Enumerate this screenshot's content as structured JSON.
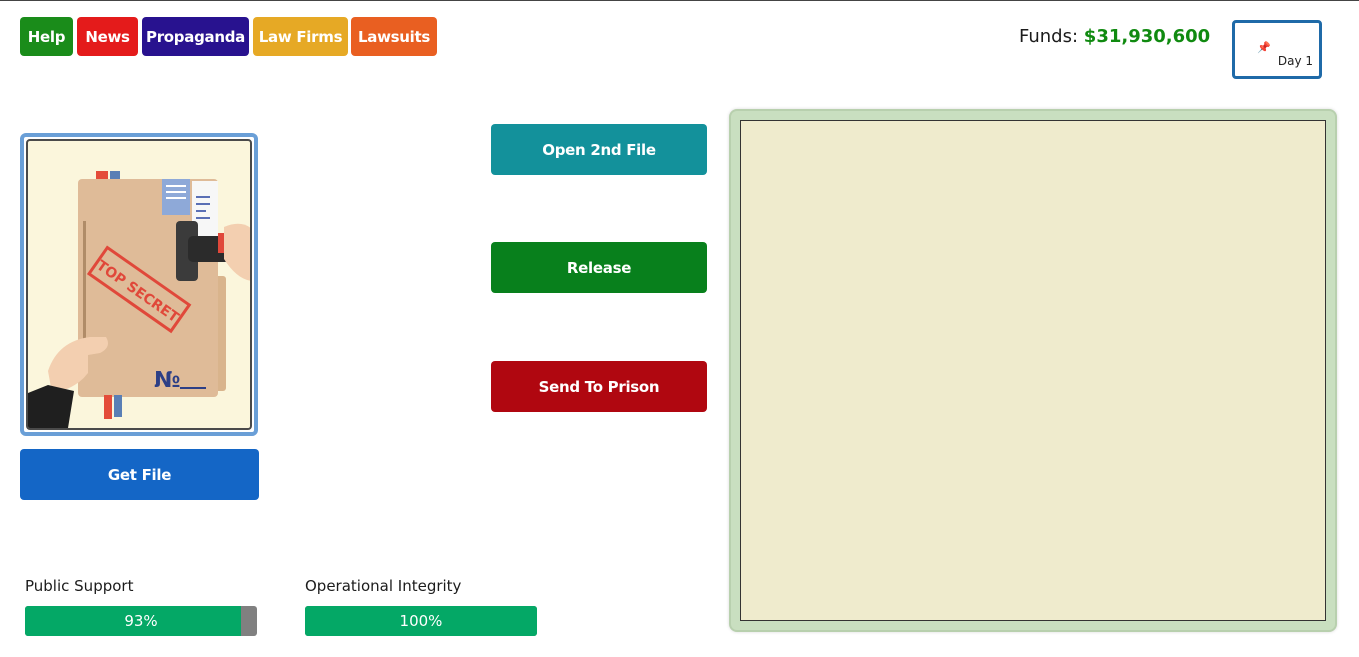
{
  "nav": {
    "help": {
      "label": "Help",
      "color": "#1a8c1a"
    },
    "news": {
      "label": "News",
      "color": "#e41b1b"
    },
    "propaganda": {
      "label": "Propaganda",
      "color": "#28128f"
    },
    "law_firms": {
      "label": "Law Firms",
      "color": "#e6a925"
    },
    "lawsuits": {
      "label": "Lawsuits",
      "color": "#e95f21"
    }
  },
  "funds": {
    "label": "Funds:",
    "amount": "$31,930,600"
  },
  "day": {
    "label": "Day 1"
  },
  "file_card": {
    "stamp_text": "TOP SECRET",
    "number_mark": "№"
  },
  "buttons": {
    "get_file": {
      "label": "Get File",
      "color": "#1466c6"
    },
    "open_second": {
      "label": "Open 2nd File",
      "color": "#13919b"
    },
    "release": {
      "label": "Release",
      "color": "#08801c"
    },
    "send_prison": {
      "label": "Send To Prison",
      "color": "#b00710"
    }
  },
  "stats": {
    "public_support": {
      "label": "Public Support",
      "value_text": "93%",
      "value": 93
    },
    "operational_integrity": {
      "label": "Operational Integrity",
      "value_text": "100%",
      "value": 100
    }
  }
}
